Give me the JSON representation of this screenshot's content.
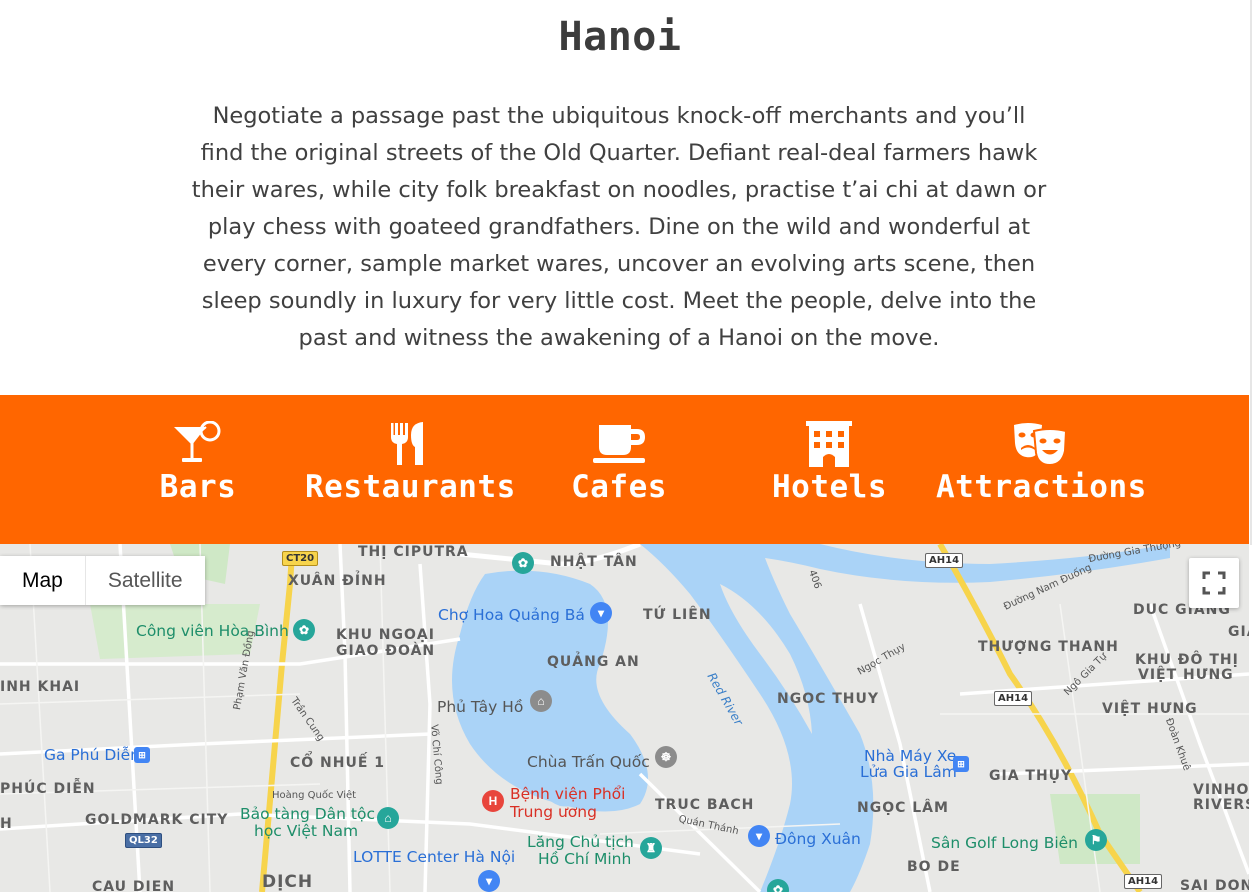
{
  "page": {
    "title": "Hanoi",
    "intro": "Negotiate a passage past the ubiquitous knock-off merchants and you’ll find the original streets of the Old Quarter. Defiant real-deal farmers hawk their wares, while city folk breakfast on noodles, practise t’ai chi at dawn or play chess with goateed grandfathers. Dine on the wild and wonderful at every corner, sample market wares, uncover an evolving arts scene, then sleep soundly in luxury for very little cost. Meet the people, delve into the past and witness the awakening of a Hanoi on the move."
  },
  "colors": {
    "accent": "#ff6600",
    "water": "#aad3f7",
    "map_bg": "#e8e8e6"
  },
  "categories": [
    {
      "label": "Bars",
      "icon": "cocktail-icon"
    },
    {
      "label": "Restaurants",
      "icon": "fork-knife-icon"
    },
    {
      "label": "Cafes",
      "icon": "coffee-cup-icon"
    },
    {
      "label": "Hotels",
      "icon": "hotel-building-icon"
    },
    {
      "label": "Attractions",
      "icon": "theater-masks-icon"
    }
  ],
  "map": {
    "type_buttons": {
      "map": "Map",
      "satellite": "Satellite"
    },
    "active_type": "Map",
    "fullscreen_icon": "fullscreen-icon",
    "areas": {
      "thi_ciputra": "THỊ CIPUTRA",
      "nhat_tan": "NHẬT TÂN",
      "xuan_dinh": "XUÂN ĐỈNH",
      "tu_lien": "TỨ LIÊN",
      "duc_giang": "DUC GIANG",
      "gia": "GIA",
      "khu_ngoai_1": "KHU NGOẠI",
      "khu_ngoai_2": "GIAO ĐOÀN",
      "quang_an": "QUẢNG AN",
      "thuong_thanh": "THƯỢNG THANH",
      "khu_do_thi_1": "KHU ĐÔ THỊ",
      "khu_do_thi_2": "VIỆT HƯNG",
      "minh_khai": "INH KHAI",
      "ngoc_thuy": "NGOC THUY",
      "viet_hung": "VIỆT HƯNG",
      "co_nhue": "CỔ NHUẾ 1",
      "phuc_dien": "PHÚC DIỄN",
      "gia_thuy": "GIA THỤY",
      "vinho_1": "VINHO",
      "vinho_2": "RIVERS",
      "truc_bach": "TRUC BACH",
      "ngoc_lam": "NGỌC LÂM",
      "goldmark": "GOLDMARK CITY",
      "h_edge": "H",
      "bo_de": "BO DE",
      "cau_dien": "CAU DIEN",
      "dich": "DỊCH",
      "sai_dong": "SAI DONG"
    },
    "pois": {
      "cong_vien": "Công viên Hòa Bình",
      "cho_hoa": "Chợ Hoa Quảng Bá",
      "phu_tay_ho": "Phủ Tây Hồ",
      "ga_phu_dien": "Ga Phú Diễn",
      "chua_tran_quoc": "Chùa Trấn Quốc",
      "nha_may_1": "Nhà Máy Xe",
      "nha_may_2": "Lửa Gia Lâm",
      "benh_vien_1": "Bệnh viện Phổi",
      "benh_vien_2": "Trung ương",
      "bao_tang_1": "Bảo tàng Dân tộc",
      "bao_tang_2": "học Việt Nam",
      "lang_1": "Lăng Chủ tịch",
      "lang_2": "Hồ Chí Minh",
      "dong_xuan": "Đông Xuân",
      "san_golf": "Sân Golf Long Biên",
      "lotte": "LOTTE Center Hà Nội"
    },
    "roads": {
      "ct20": "CT20",
      "ah14_top": "AH14",
      "ah14_mid": "AH14",
      "ah14_bot": "AH14",
      "ql32": "QL32",
      "pham_van_dong": "Phạm Văn Đồng",
      "tran_cung": "Trần Cung",
      "vo_chi_cong": "Võ Chí Công",
      "hoang_quoc_viet": "Hoàng Quốc Việt",
      "quan_thanh": "Quán Thánh",
      "duong_gia_thuong": "Đường Gia Thượng",
      "duong_nam_duong": "Đường Nam Đuống",
      "ngoc_thuy_rd": "Ngọc Thụy",
      "ngo_gia_tu": "Ngô Gia Tự",
      "doan_khue": "Đoàn Khuê",
      "r406": "406",
      "red_river": "Red River"
    }
  }
}
